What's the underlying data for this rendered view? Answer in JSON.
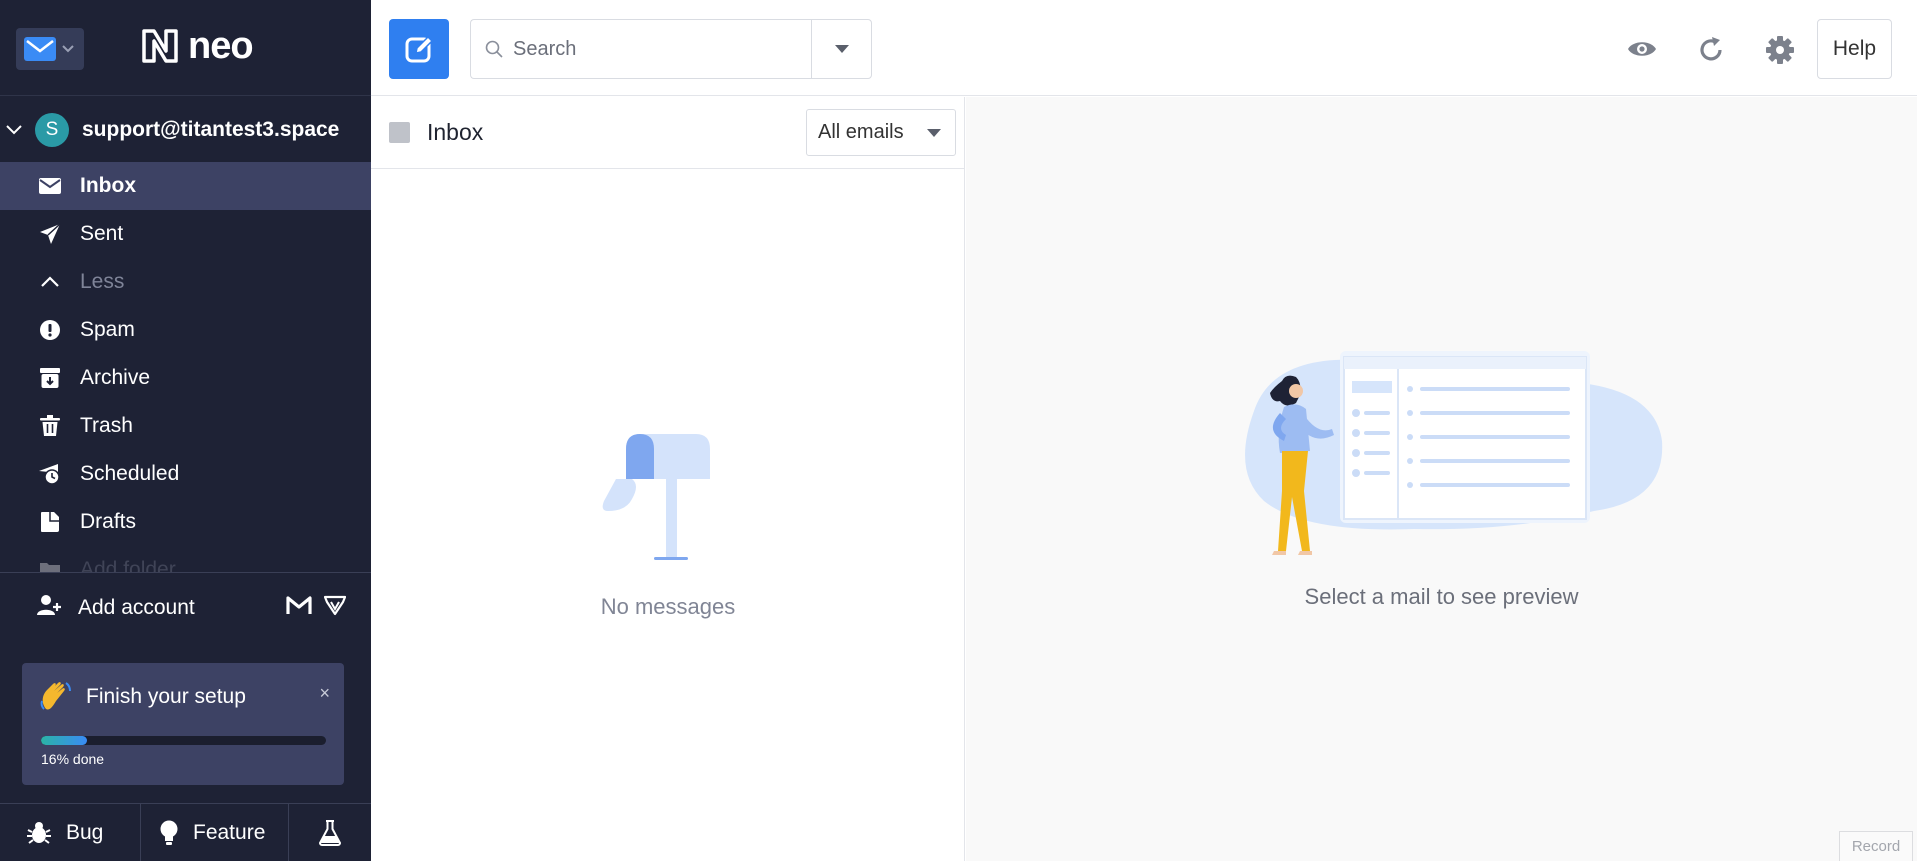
{
  "brand": {
    "name": "neo",
    "accent": "#2f7ff0",
    "sidebar_bg": "#1e2235"
  },
  "account": {
    "initial": "S",
    "email": "support@titantest3.space"
  },
  "folders": [
    {
      "label": "Inbox",
      "icon": "envelope-icon",
      "active": true
    },
    {
      "label": "Sent",
      "icon": "paper-plane-icon"
    },
    {
      "label": "Less",
      "icon": "chevron-up-icon",
      "muted": true
    },
    {
      "label": "Spam",
      "icon": "exclamation-circle-icon"
    },
    {
      "label": "Archive",
      "icon": "archive-box-icon"
    },
    {
      "label": "Trash",
      "icon": "trash-icon"
    },
    {
      "label": "Scheduled",
      "icon": "clock-icon"
    },
    {
      "label": "Drafts",
      "icon": "draft-icon"
    },
    {
      "label": "Add folder",
      "icon": "add-folder-icon"
    }
  ],
  "add_account": {
    "label": "Add account"
  },
  "setup": {
    "title": "Finish your setup",
    "progress_percent": 16,
    "done_label": "16% done",
    "close": "×"
  },
  "footer": {
    "bug": "Bug",
    "feature": "Feature"
  },
  "toolbar": {
    "search_placeholder": "Search",
    "help": "Help"
  },
  "list": {
    "title": "Inbox",
    "filter": "All emails",
    "empty": "No messages"
  },
  "preview": {
    "empty": "Select a mail to see preview",
    "record": "Record"
  }
}
